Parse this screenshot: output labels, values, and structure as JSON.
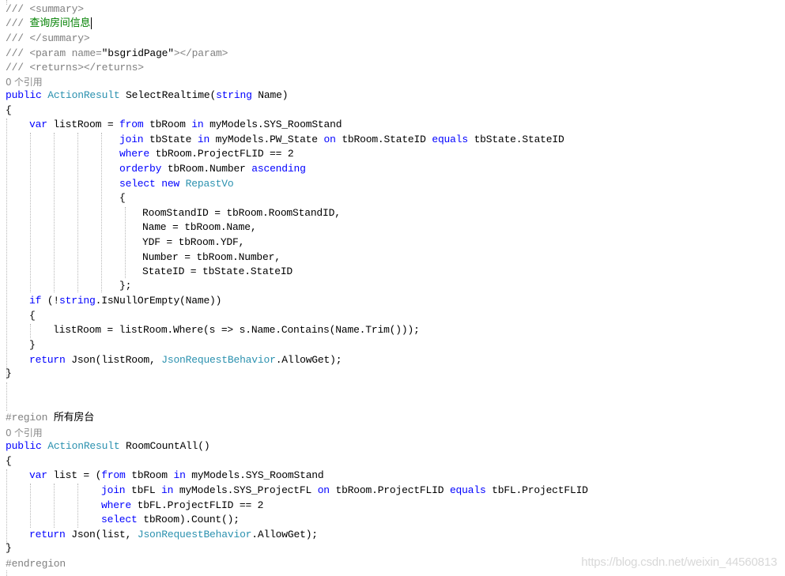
{
  "xml_doc": {
    "summary_open": "/// <summary>",
    "summary_prefix": "/// ",
    "summary_text": "查询房间信息",
    "summary_close": "/// </summary>",
    "param_prefix": "/// <param name=",
    "param_value": "\"bsgridPage\"",
    "param_suffix": "></param>",
    "returns": "/// <returns></returns>"
  },
  "references_label": "0 个引用",
  "method1": {
    "keyword_public": "public",
    "return_type": "ActionResult",
    "name": "SelectRealtime(",
    "param_type": "string",
    "param_name": "Name)",
    "open_brace": "{",
    "l_var_kw": "var",
    "l_var_text": "listRoom = ",
    "l_from_kw": "from",
    "l_from_text": "tbRoom",
    "l_in_kw": "in",
    "l_from_src": "myModels.SYS_RoomStand",
    "l_join_kw": "join",
    "l_join_var": "tbState",
    "l_join_in": "in",
    "l_join_src": "myModels.PW_State",
    "l_join_on": "on",
    "l_join_left": "tbRoom.StateID",
    "l_join_equals": "equals",
    "l_join_right": "tbState.StateID",
    "l_where_kw": "where",
    "l_where_text": "tbRoom.ProjectFLID == 2",
    "l_orderby_kw": "orderby",
    "l_orderby_text": "tbRoom.Number",
    "l_ascending_kw": "ascending",
    "l_select_kw": "select",
    "l_new_kw": "new",
    "l_select_type": "RepastVo",
    "l_init_open": "{",
    "l_init_1": "RoomStandID = tbRoom.RoomStandID,",
    "l_init_2": "Name = tbRoom.Name,",
    "l_init_3": "YDF = tbRoom.YDF,",
    "l_init_4": "Number = tbRoom.Number,",
    "l_init_5": "StateID = tbState.StateID",
    "l_init_close": "};",
    "l_if_kw": "if",
    "l_if_open": " (!",
    "l_if_string": "string",
    "l_if_rest": ".IsNullOrEmpty(Name))",
    "l_if_brace_open": "{",
    "l_if_body": "listRoom = listRoom.Where(s => s.Name.Contains(Name.Trim()));",
    "l_if_brace_close": "}",
    "l_return_kw": "return",
    "l_return_text": "Json(listRoom, ",
    "l_return_type": "JsonRequestBehavior",
    "l_return_end": ".AllowGet);",
    "close_brace": "}"
  },
  "region": {
    "directive": "#region",
    "name": "所有房台",
    "end": "#endregion"
  },
  "method2": {
    "keyword_public": "public",
    "return_type": "ActionResult",
    "name": "RoomCountAll()",
    "open_brace": "{",
    "l_var_kw": "var",
    "l_var_text": "list = (",
    "l_from_kw": "from",
    "l_from_text": "tbRoom",
    "l_in_kw": "in",
    "l_from_src": "myModels.SYS_RoomStand",
    "l_join_kw": "join",
    "l_join_var": "tbFL",
    "l_join_in": "in",
    "l_join_src": "myModels.SYS_ProjectFL",
    "l_join_on": "on",
    "l_join_left": "tbRoom.ProjectFLID",
    "l_join_equals": "equals",
    "l_join_right": "tbFL.ProjectFLID",
    "l_where_kw": "where",
    "l_where_text": "tbFL.ProjectFLID == 2",
    "l_select_kw": "select",
    "l_select_text": "tbRoom).Count();",
    "l_return_kw": "return",
    "l_return_text": "Json(list, ",
    "l_return_type": "JsonRequestBehavior",
    "l_return_end": ".AllowGet);",
    "close_brace": "}"
  },
  "watermark": "https://blog.csdn.net/weixin_44560813",
  "colors": {
    "keyword": "#0000ff",
    "type": "#2b91af",
    "comment_gray": "#808080",
    "comment_green": "#008000",
    "guide": "#b8b8b8"
  }
}
